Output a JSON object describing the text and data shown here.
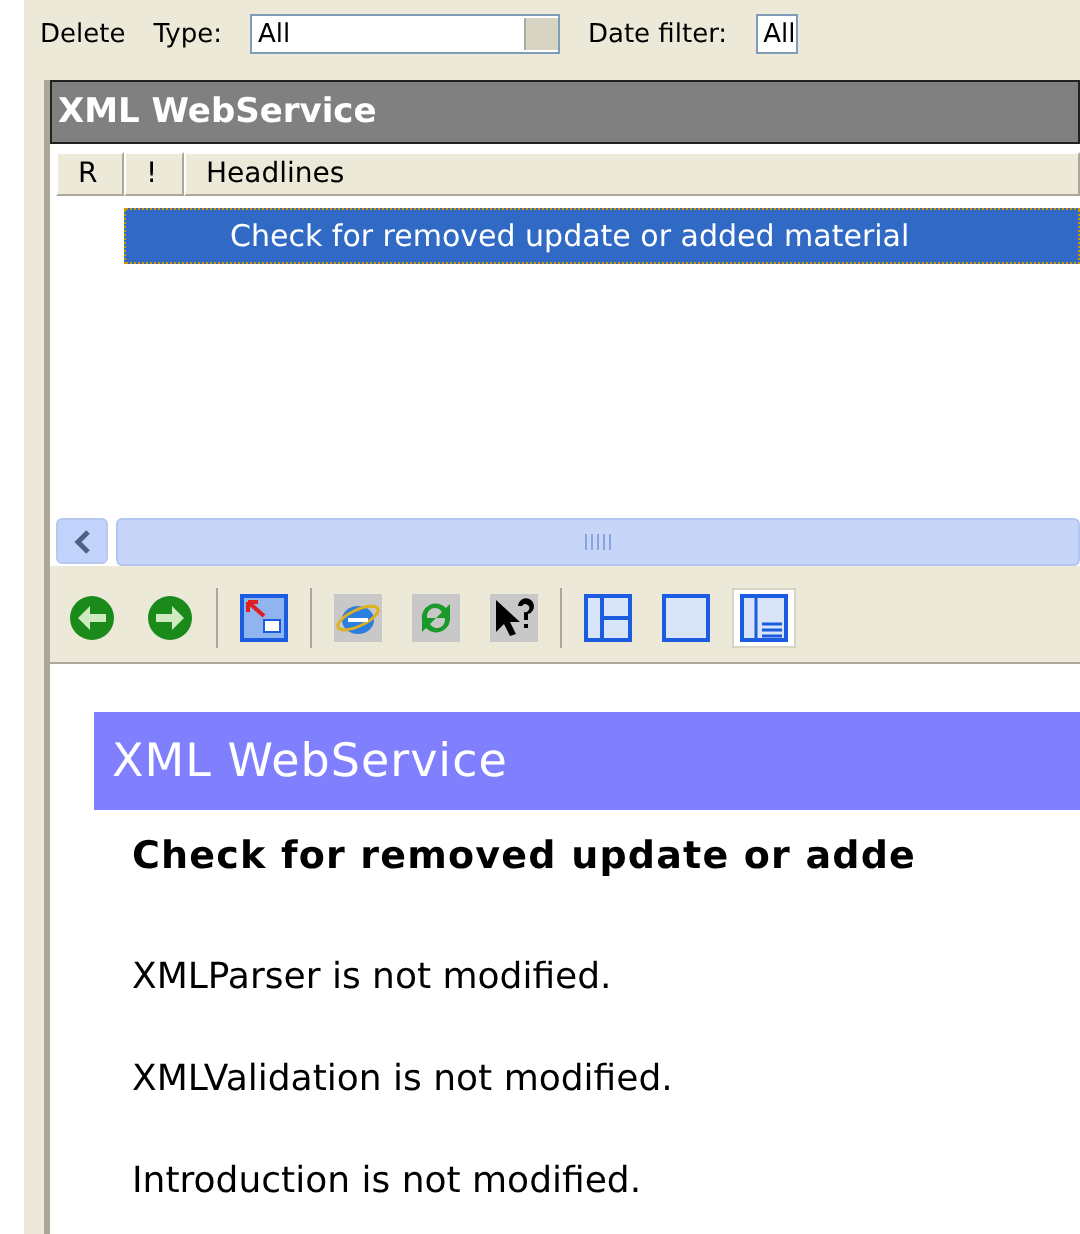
{
  "filter_bar": {
    "delete_label": "Delete",
    "type_label": "Type:",
    "type_value": "All",
    "date_label": "Date filter:",
    "date_value": "All"
  },
  "panel": {
    "title": "XML WebService",
    "columns": [
      "R",
      "!",
      "Headlines"
    ],
    "rows": [
      {
        "headline": "Check for removed update or added material",
        "selected": true
      }
    ]
  },
  "preview": {
    "title": "XML WebService",
    "heading": "Check for removed update or adde",
    "paragraphs": [
      "XMLParser is not modified.",
      "XMLValidation is not modified.",
      "Introduction is not modified."
    ]
  }
}
